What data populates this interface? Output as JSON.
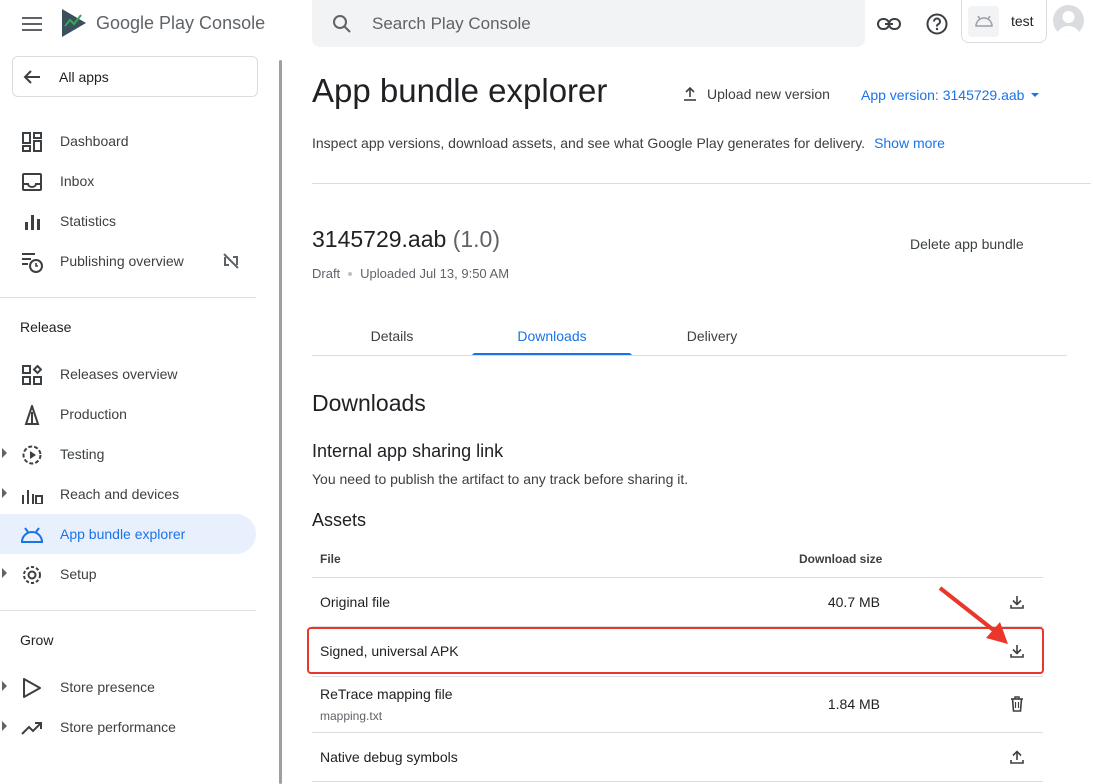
{
  "header": {
    "brand": "Google Play Console",
    "search_placeholder": "Search Play Console",
    "account_name": "test"
  },
  "sidebar": {
    "all_apps": "All apps",
    "items_top": [
      {
        "label": "Dashboard",
        "icon": "dashboard-icon"
      },
      {
        "label": "Inbox",
        "icon": "inbox-icon"
      },
      {
        "label": "Statistics",
        "icon": "bar-chart-icon"
      },
      {
        "label": "Publishing overview",
        "icon": "publishing-icon"
      }
    ],
    "release_title": "Release",
    "release_items": [
      {
        "label": "Releases overview",
        "icon": "releases-icon"
      },
      {
        "label": "Production",
        "icon": "production-icon"
      },
      {
        "label": "Testing",
        "icon": "testing-icon"
      },
      {
        "label": "Reach and devices",
        "icon": "reach-icon"
      },
      {
        "label": "App bundle explorer",
        "icon": "android-icon"
      },
      {
        "label": "Setup",
        "icon": "gear-icon"
      }
    ],
    "grow_title": "Grow",
    "grow_items": [
      {
        "label": "Store presence",
        "icon": "store-presence-icon"
      },
      {
        "label": "Store performance",
        "icon": "trending-icon"
      }
    ]
  },
  "main": {
    "title": "App bundle explorer",
    "upload_label": "Upload new version",
    "version_label": "App version: 3145729.aab",
    "description": "Inspect app versions, download assets, and see what Google Play generates for delivery.",
    "show_more": "Show more",
    "bundle_name": "3145729.aab",
    "bundle_version": "(1.0)",
    "delete_label": "Delete app bundle",
    "status": "Draft",
    "uploaded": "Uploaded Jul 13, 9:50 AM",
    "tabs": [
      "Details",
      "Downloads",
      "Delivery"
    ],
    "active_tab": "Downloads",
    "downloads_title": "Downloads",
    "sharing_title": "Internal app sharing link",
    "sharing_note": "You need to publish the artifact to any track before sharing it.",
    "assets_title": "Assets",
    "columns": {
      "file": "File",
      "size": "Download size"
    },
    "rows": [
      {
        "name": "Original file",
        "sub": "",
        "size": "40.7 MB",
        "action": "download-icon"
      },
      {
        "name": "Signed, universal APK",
        "sub": "",
        "size": "",
        "action": "download-icon"
      },
      {
        "name": "ReTrace mapping file",
        "sub": "mapping.txt",
        "size": "1.84 MB",
        "action": "delete-icon"
      },
      {
        "name": "Native debug symbols",
        "sub": "",
        "size": "",
        "action": "upload-icon"
      }
    ]
  },
  "colors": {
    "accent": "#1a73e8",
    "highlight": "#e9372b"
  }
}
